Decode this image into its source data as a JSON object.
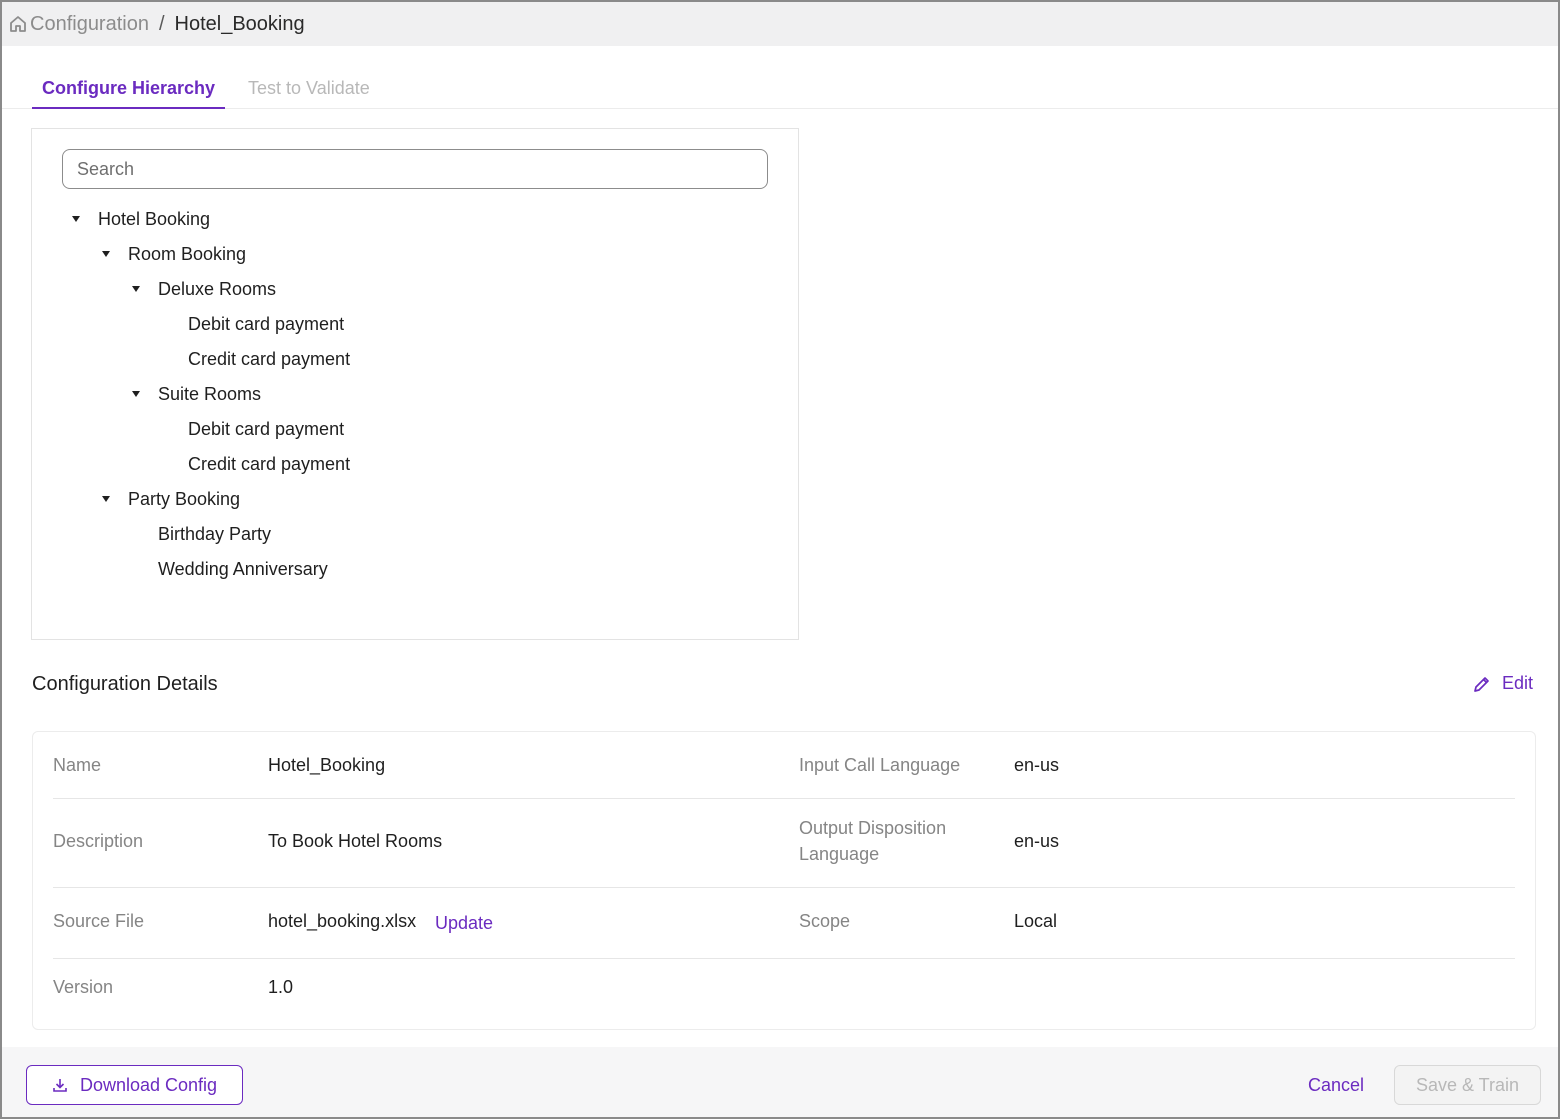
{
  "breadcrumb": {
    "home_icon": "home-icon",
    "parent": "Configuration",
    "separator": "/",
    "current": "Hotel_Booking"
  },
  "tabs": [
    {
      "label": "Configure Hierarchy",
      "active": true
    },
    {
      "label": "Test to Validate",
      "active": false
    }
  ],
  "search": {
    "placeholder": "Search",
    "value": ""
  },
  "tree": [
    {
      "label": "Hotel Booking",
      "level": 0,
      "expanded": true
    },
    {
      "label": "Room Booking",
      "level": 1,
      "expanded": true
    },
    {
      "label": "Deluxe Rooms",
      "level": 2,
      "expanded": true
    },
    {
      "label": "Debit card payment",
      "level": 3
    },
    {
      "label": "Credit card payment",
      "level": 3
    },
    {
      "label": "Suite Rooms",
      "level": 2,
      "expanded": true
    },
    {
      "label": "Debit card payment",
      "level": 3
    },
    {
      "label": "Credit card payment",
      "level": 3
    },
    {
      "label": "Party Booking",
      "level": 1,
      "expanded": true
    },
    {
      "label": "Birthday Party",
      "level": 2
    },
    {
      "label": "Wedding Anniversary",
      "level": 2
    }
  ],
  "details": {
    "title": "Configuration Details",
    "edit_label": "Edit",
    "name_label": "Name",
    "name_value": "Hotel_Booking",
    "input_lang_label": "Input Call Language",
    "input_lang_value": "en-us",
    "description_label": "Description",
    "description_value": "To Book Hotel Rooms",
    "output_lang_label_line1": "Output Disposition",
    "output_lang_label_line2": "Language",
    "output_lang_value": "en-us",
    "source_label": "Source File",
    "source_value": "hotel_booking.xlsx",
    "update_label": "Update",
    "scope_label": "Scope",
    "scope_value": "Local",
    "version_label": "Version",
    "version_value": "1.0"
  },
  "footer": {
    "download_label": "Download Config",
    "cancel_label": "Cancel",
    "save_label": "Save & Train"
  },
  "colors": {
    "accent": "#6b2bc0",
    "muted_text": "#858585",
    "disabled_text": "#b8b8b8"
  }
}
